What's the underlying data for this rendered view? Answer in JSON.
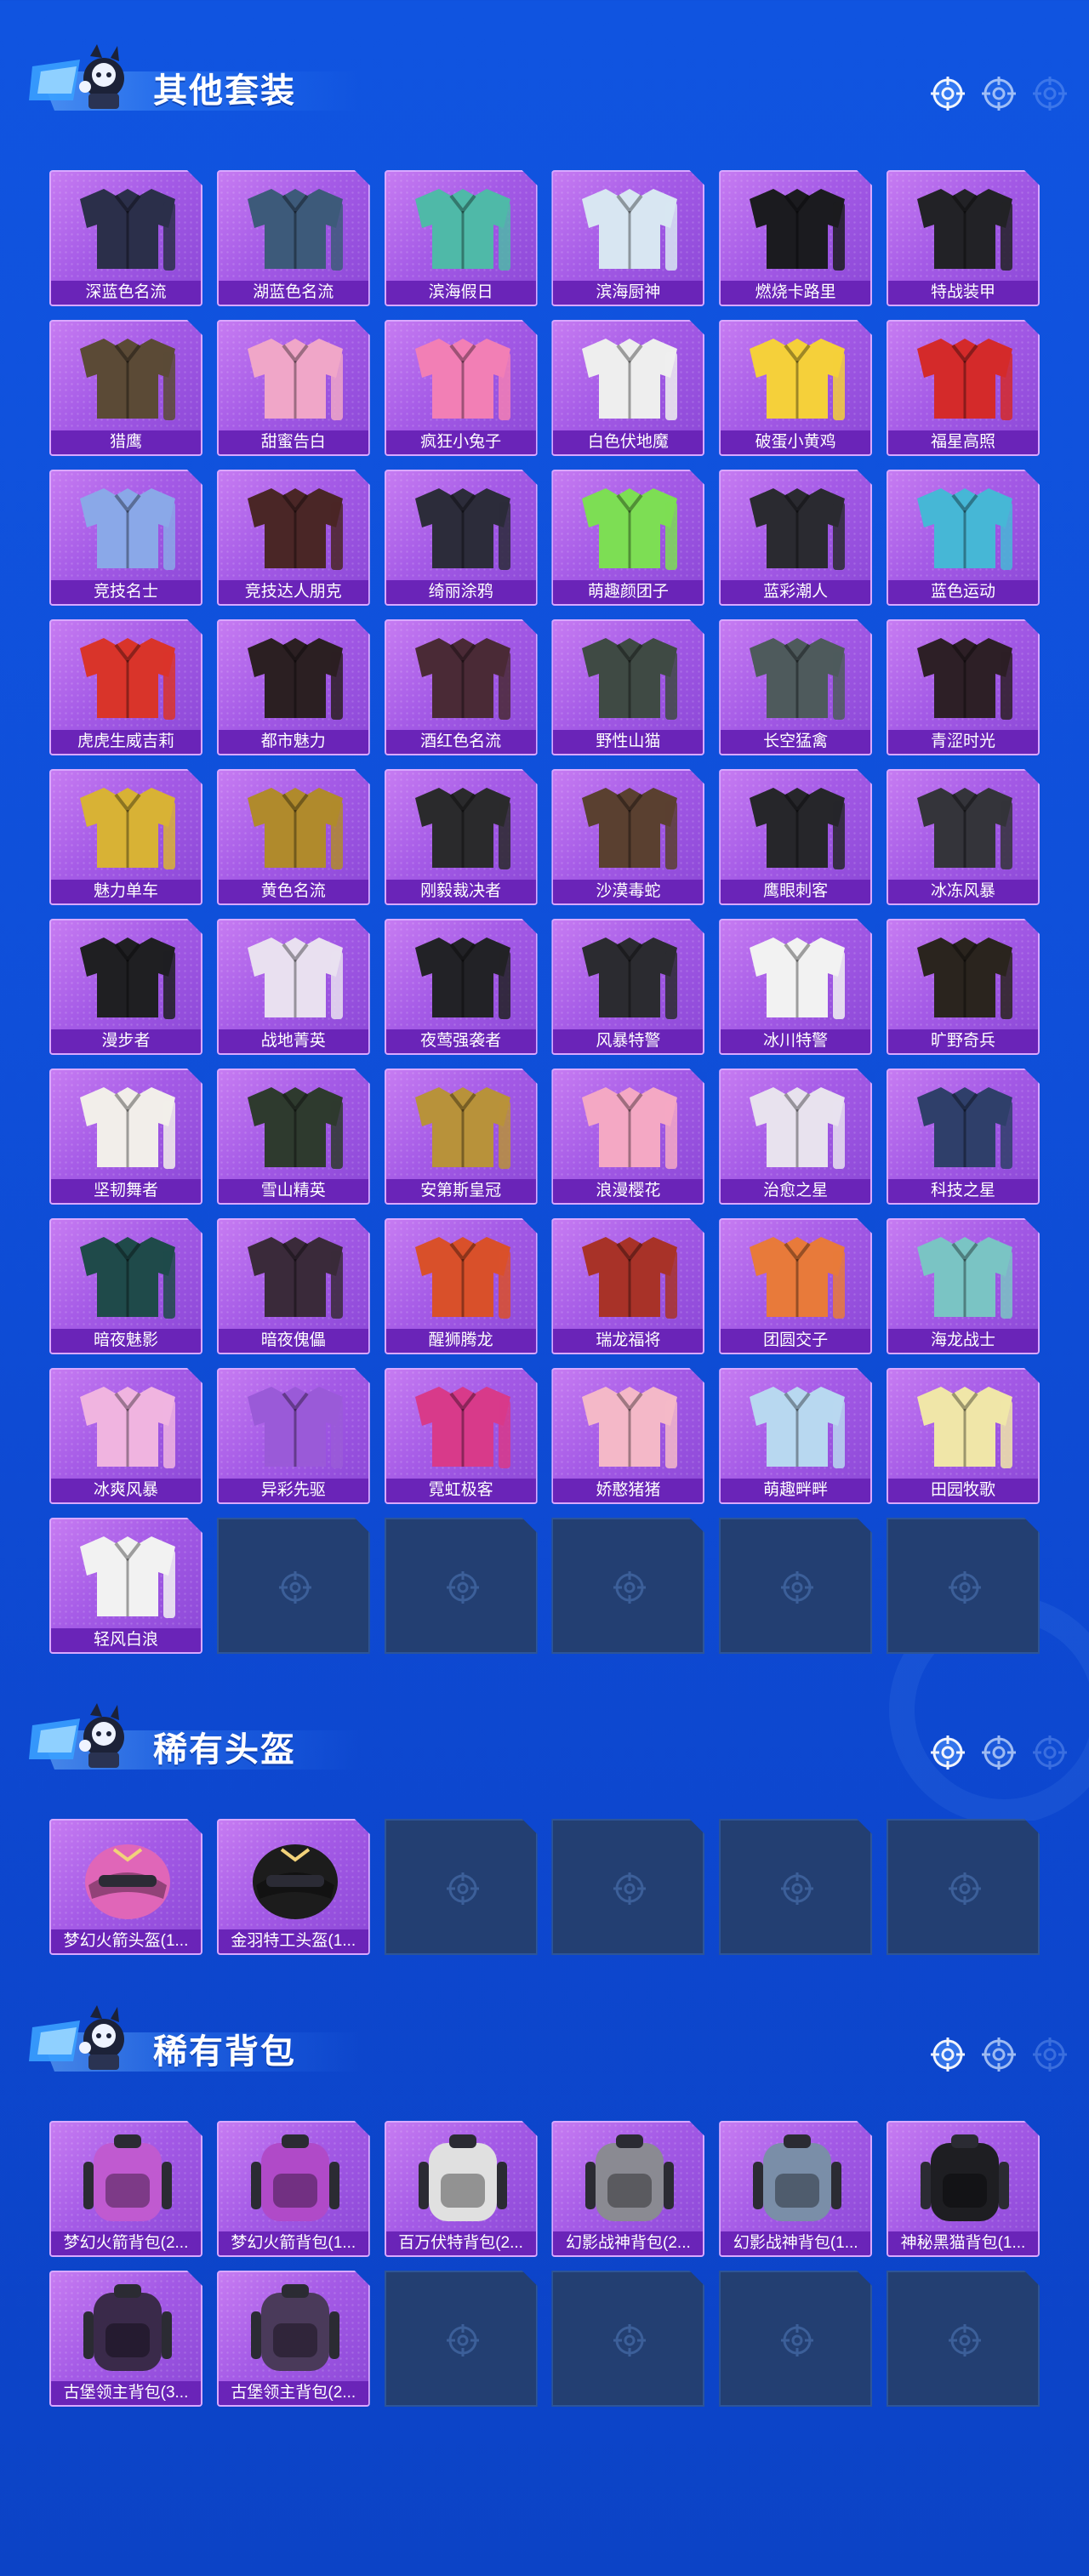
{
  "sections": [
    {
      "title": "其他套装",
      "cards": [
        {
          "label": "深蓝色名流",
          "icon": "suit-icon",
          "color": "#2b2f4a"
        },
        {
          "label": "湖蓝色名流",
          "icon": "suit-icon",
          "color": "#3d5a7a"
        },
        {
          "label": "滨海假日",
          "icon": "outfit-icon",
          "color": "#4fb9a8"
        },
        {
          "label": "滨海厨神",
          "icon": "outfit-icon",
          "color": "#d8e6f2"
        },
        {
          "label": "燃烧卡路里",
          "icon": "outfit-icon",
          "color": "#1b1b1f"
        },
        {
          "label": "特战装甲",
          "icon": "armor-icon",
          "color": "#222226"
        },
        {
          "label": "猎鹰",
          "icon": "jacket-icon",
          "color": "#5b4a36"
        },
        {
          "label": "甜蜜告白",
          "icon": "outfit-icon",
          "color": "#f0a6c8"
        },
        {
          "label": "疯狂小兔子",
          "icon": "costume-icon",
          "color": "#f27fb5"
        },
        {
          "label": "白色伏地魔",
          "icon": "hoodie-icon",
          "color": "#eeeeee"
        },
        {
          "label": "破蛋小黄鸡",
          "icon": "costume-icon",
          "color": "#f5d03a"
        },
        {
          "label": "福星高照",
          "icon": "costume-icon",
          "color": "#d42a2a"
        },
        {
          "label": "竞技名士",
          "icon": "jacket-icon",
          "color": "#8aa8e8"
        },
        {
          "label": "竞技达人朋克",
          "icon": "outfit-icon",
          "color": "#4a2626"
        },
        {
          "label": "绮丽涂鸦",
          "icon": "suit-icon",
          "color": "#2c2c3a"
        },
        {
          "label": "萌趣颜团子",
          "icon": "costume-icon",
          "color": "#7dde54"
        },
        {
          "label": "蓝彩潮人",
          "icon": "jacket-icon",
          "color": "#2a2a30"
        },
        {
          "label": "蓝色运动",
          "icon": "jacket-icon",
          "color": "#46b7d6"
        },
        {
          "label": "虎虎生威吉莉",
          "icon": "outfit-icon",
          "color": "#d9342a"
        },
        {
          "label": "都市魅力",
          "icon": "outfit-icon",
          "color": "#2b1f22"
        },
        {
          "label": "酒红色名流",
          "icon": "suit-icon",
          "color": "#4a2a36"
        },
        {
          "label": "野性山猫",
          "icon": "camo-icon",
          "color": "#3f4a44"
        },
        {
          "label": "长空猛禽",
          "icon": "camo-icon",
          "color": "#4e5a5c"
        },
        {
          "label": "青涩时光",
          "icon": "outfit-icon",
          "color": "#2d1f26"
        },
        {
          "label": "魅力单车",
          "icon": "outfit-icon",
          "color": "#d8b235"
        },
        {
          "label": "黄色名流",
          "icon": "suit-icon",
          "color": "#b08a2c"
        },
        {
          "label": "刚毅裁决者",
          "icon": "armor-icon",
          "color": "#2a2a2c"
        },
        {
          "label": "沙漠毒蛇",
          "icon": "armor-icon",
          "color": "#5a4030"
        },
        {
          "label": "鹰眼刺客",
          "icon": "armor-icon",
          "color": "#26262a"
        },
        {
          "label": "冰冻风暴",
          "icon": "armor-icon",
          "color": "#34343a"
        },
        {
          "label": "漫步者",
          "icon": "outfit-icon",
          "color": "#1f1f22"
        },
        {
          "label": "战地菁英",
          "icon": "outfit-icon",
          "color": "#e9e0f0"
        },
        {
          "label": "夜莺强袭者",
          "icon": "armor-icon",
          "color": "#222226"
        },
        {
          "label": "风暴特警",
          "icon": "armor-icon",
          "color": "#2b2b30"
        },
        {
          "label": "冰川特警",
          "icon": "outfit-icon",
          "color": "#f2f2f2"
        },
        {
          "label": "旷野奇兵",
          "icon": "armor-icon",
          "color": "#2a241e"
        },
        {
          "label": "坚韧舞者",
          "icon": "outfit-icon",
          "color": "#f2eeea"
        },
        {
          "label": "雪山精英",
          "icon": "armor-icon",
          "color": "#2e3a2e"
        },
        {
          "label": "安第斯皇冠",
          "icon": "coat-icon",
          "color": "#b8923a"
        },
        {
          "label": "浪漫樱花",
          "icon": "costume-icon",
          "color": "#f4a8c4"
        },
        {
          "label": "治愈之星",
          "icon": "outfit-icon",
          "color": "#e8e2ee"
        },
        {
          "label": "科技之星",
          "icon": "armor-icon",
          "color": "#2f3f6a"
        },
        {
          "label": "暗夜魅影",
          "icon": "costume-icon",
          "color": "#1f4a4a"
        },
        {
          "label": "暗夜傀儡",
          "icon": "costume-icon",
          "color": "#3a2a3a"
        },
        {
          "label": "醒狮腾龙",
          "icon": "costume-icon",
          "color": "#d9502a"
        },
        {
          "label": "瑞龙福将",
          "icon": "costume-icon",
          "color": "#a83228"
        },
        {
          "label": "团圆交子",
          "icon": "costume-icon",
          "color": "#e87a3a"
        },
        {
          "label": "海龙战士",
          "icon": "armor-icon",
          "color": "#7ac4c4"
        },
        {
          "label": "冰爽风暴",
          "icon": "costume-icon",
          "color": "#f0b4e0"
        },
        {
          "label": "异彩先驱",
          "icon": "costume-icon",
          "color": "#9a5ad8"
        },
        {
          "label": "霓虹极客",
          "icon": "costume-icon",
          "color": "#d83a8a"
        },
        {
          "label": "娇憨猪猪",
          "icon": "costume-icon",
          "color": "#f4b8c8"
        },
        {
          "label": "萌趣畔畔",
          "icon": "costume-icon",
          "color": "#b8d8f0"
        },
        {
          "label": "田园牧歌",
          "icon": "costume-icon",
          "color": "#f0e6a8"
        },
        {
          "label": "轻风白浪",
          "icon": "outfit-icon",
          "color": "#f2f2f2"
        }
      ],
      "empty_slots": 5
    },
    {
      "title": "稀有头盔",
      "cards": [
        {
          "label": "梦幻火箭头盔(1...",
          "icon": "helmet-icon",
          "color": "#e066b8"
        },
        {
          "label": "金羽特工头盔(1...",
          "icon": "helmet-icon",
          "color": "#1c1c1c"
        }
      ],
      "empty_slots": 4
    },
    {
      "title": "稀有背包",
      "cards": [
        {
          "label": "梦幻火箭背包(2...",
          "icon": "backpack-icon",
          "color": "#c05ad0"
        },
        {
          "label": "梦幻火箭背包(1...",
          "icon": "backpack-icon",
          "color": "#b04ac8"
        },
        {
          "label": "百万伏特背包(2...",
          "icon": "backpack-icon",
          "color": "#e0e0e0"
        },
        {
          "label": "幻影战神背包(2...",
          "icon": "backpack-icon",
          "color": "#8a8a92"
        },
        {
          "label": "幻影战神背包(1...",
          "icon": "backpack-icon",
          "color": "#7a8ea8"
        },
        {
          "label": "神秘黑猫背包(1...",
          "icon": "backpack-icon",
          "color": "#1e1e22"
        },
        {
          "label": "古堡领主背包(3...",
          "icon": "backpack-icon",
          "color": "#3a2a4a"
        },
        {
          "label": "古堡领主背包(2...",
          "icon": "backpack-icon",
          "color": "#4a3a5a"
        }
      ],
      "empty_slots": 4
    }
  ]
}
